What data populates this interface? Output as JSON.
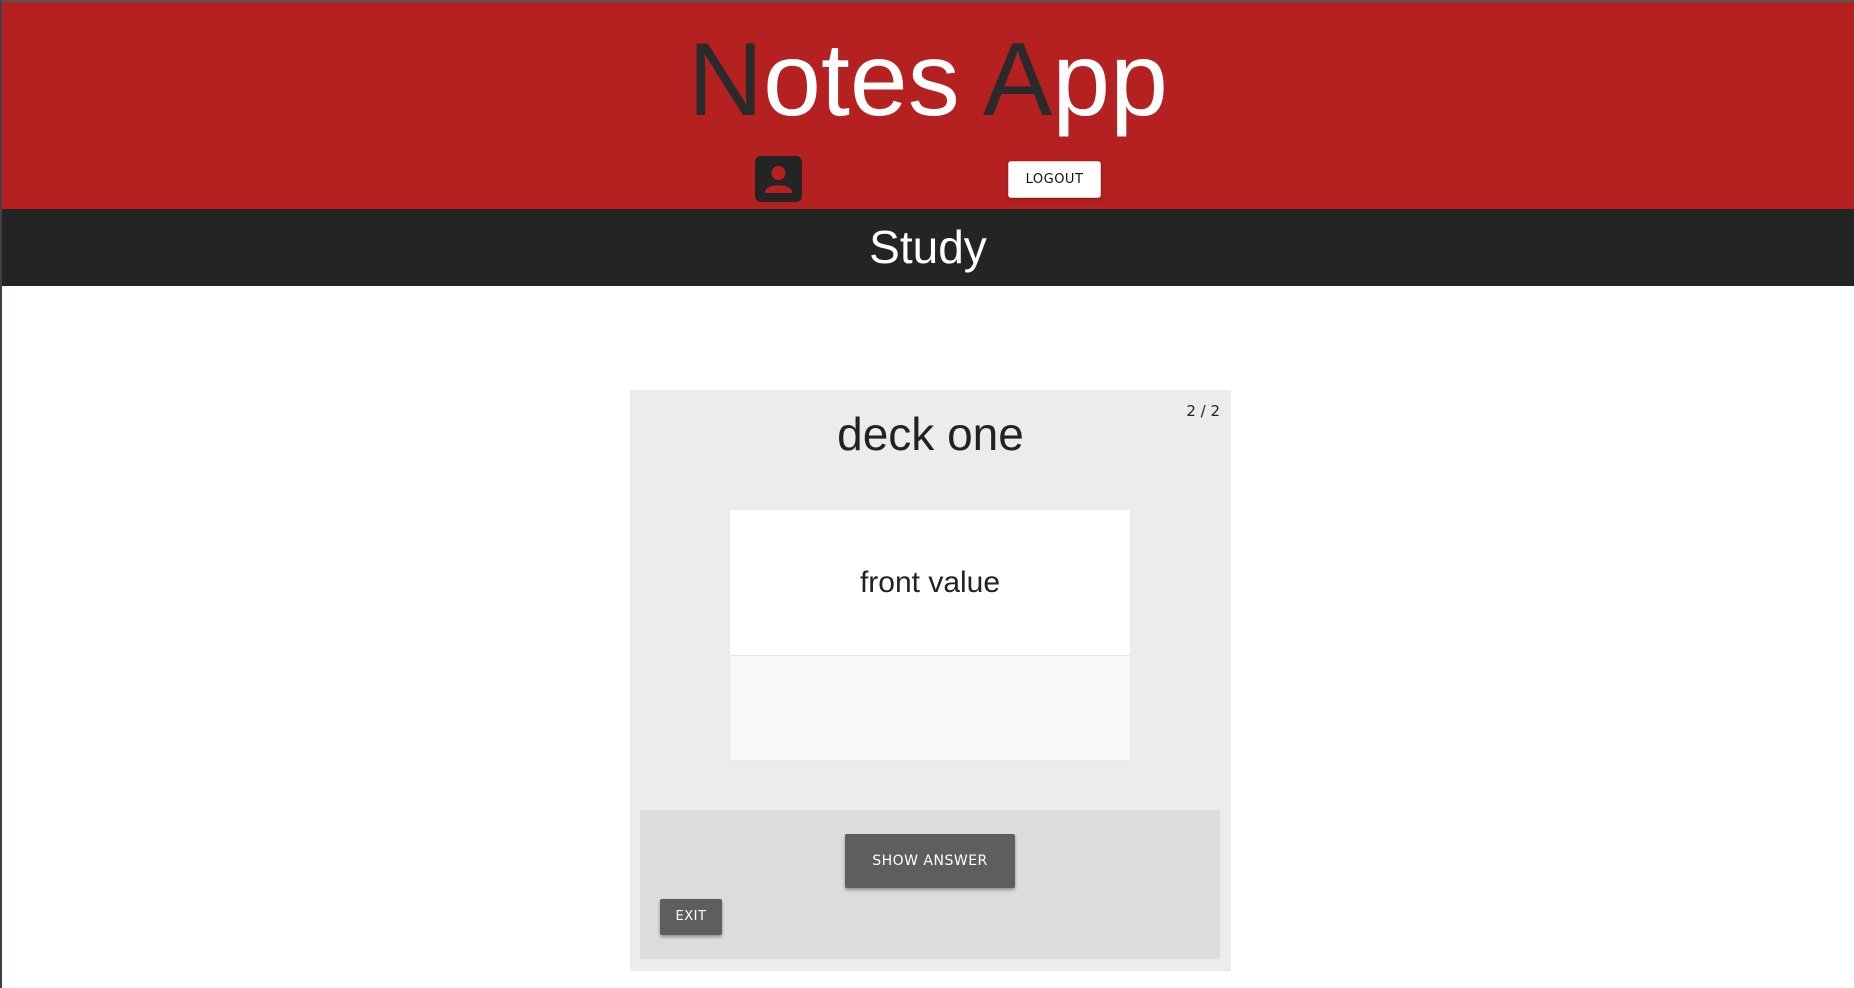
{
  "header": {
    "title_first_initial": "N",
    "title_first_rest": "otes",
    "title_second_initial": "A",
    "title_second_rest": "pp",
    "user_icon": "account-box-icon",
    "logout_label": "LOGOUT",
    "background_color": "#b52020"
  },
  "section": {
    "title": "Study",
    "background_color": "#242424"
  },
  "study": {
    "deck_name": "deck one",
    "progress": "2 / 2",
    "card_front": "front value",
    "card_back": "",
    "show_answer_label": "SHOW ANSWER",
    "exit_label": "EXIT"
  }
}
